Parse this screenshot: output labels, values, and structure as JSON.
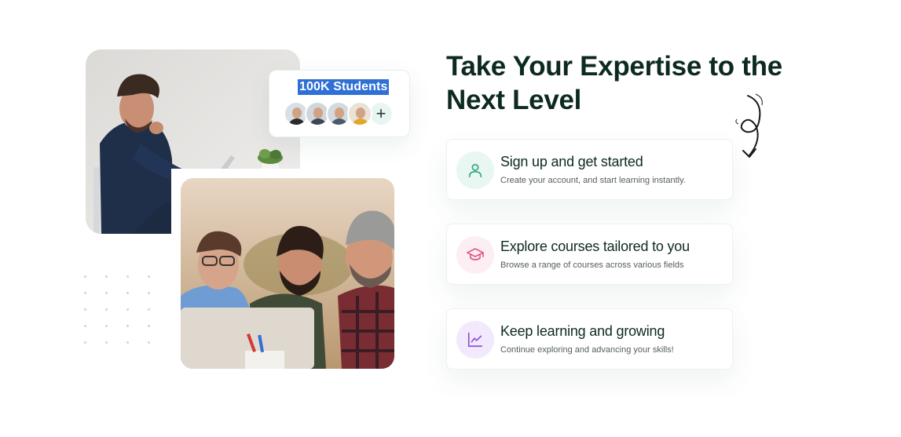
{
  "students": {
    "title": "100K Students",
    "avatars": [
      {
        "icon": "avatar-1",
        "shirt": "#2b2b2b",
        "bg": "#d8dfe6"
      },
      {
        "icon": "avatar-2",
        "shirt": "#3a4758",
        "bg": "#cfd6dc"
      },
      {
        "icon": "avatar-3",
        "shirt": "#4b5a6d",
        "bg": "#d3d9df"
      },
      {
        "icon": "avatar-4",
        "shirt": "#e0a82a",
        "bg": "#e9e2d7"
      }
    ],
    "add_icon": "plus-icon",
    "add_label": "+"
  },
  "hero": {
    "heading": "Take Your Expertise to the Next Level",
    "decoration_icon": "squiggle-arrow-icon"
  },
  "steps": [
    {
      "title": "Sign up and get started",
      "description": "Create your account, and start learning instantly.",
      "icon": "user-icon",
      "icon_color": "#2fa87c",
      "icon_bg": "#e8f7f1"
    },
    {
      "title": "Explore courses tailored to you",
      "description": "Browse a range of courses across various fields",
      "icon": "graduation-cap-icon",
      "icon_color": "#e05a86",
      "icon_bg": "#fdeef3"
    },
    {
      "title": "Keep learning and growing",
      "description": "Continue exploring and advancing your skills!",
      "icon": "line-chart-icon",
      "icon_color": "#8b4fd6",
      "icon_bg": "#f2eafc"
    }
  ],
  "images": {
    "photo_top": "man-working-on-laptop-photo",
    "photo_bottom": "three-men-looking-at-laptop-photo"
  }
}
